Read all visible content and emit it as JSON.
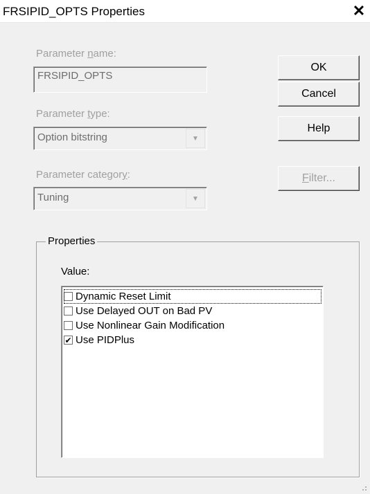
{
  "window": {
    "title": "FRSIPID_OPTS Properties",
    "close_icon": "close-icon"
  },
  "parameter_name": {
    "label_prefix": "Parameter ",
    "label_accel": "n",
    "label_suffix": "ame:",
    "value": "FRSIPID_OPTS"
  },
  "parameter_type": {
    "label_prefix": "Parameter ",
    "label_accel": "t",
    "label_suffix": "ype:",
    "value": "Option bitstring",
    "arrow_icon": "chevron-down-icon"
  },
  "parameter_category": {
    "label_prefix": "Parameter categor",
    "label_accel": "y",
    "label_suffix": ":",
    "value": "Tuning",
    "arrow_icon": "chevron-down-icon"
  },
  "buttons": {
    "ok": "OK",
    "cancel": "Cancel",
    "help": "Help",
    "filter_accel": "F",
    "filter_rest": "ilter..."
  },
  "properties": {
    "group_title": "Properties",
    "value_label": "Value:",
    "items": [
      {
        "label": "Dynamic Reset Limit",
        "checked": false,
        "mark": ""
      },
      {
        "label": "Use Delayed OUT on Bad PV",
        "checked": false,
        "mark": ""
      },
      {
        "label": "Use Nonlinear Gain Modification",
        "checked": false,
        "mark": ""
      },
      {
        "label": "Use PIDPlus",
        "checked": true,
        "mark": "✔"
      }
    ]
  },
  "colors": {
    "dialog_bg": "#f0f0f0",
    "disabled_text": "#a0a0a0"
  }
}
